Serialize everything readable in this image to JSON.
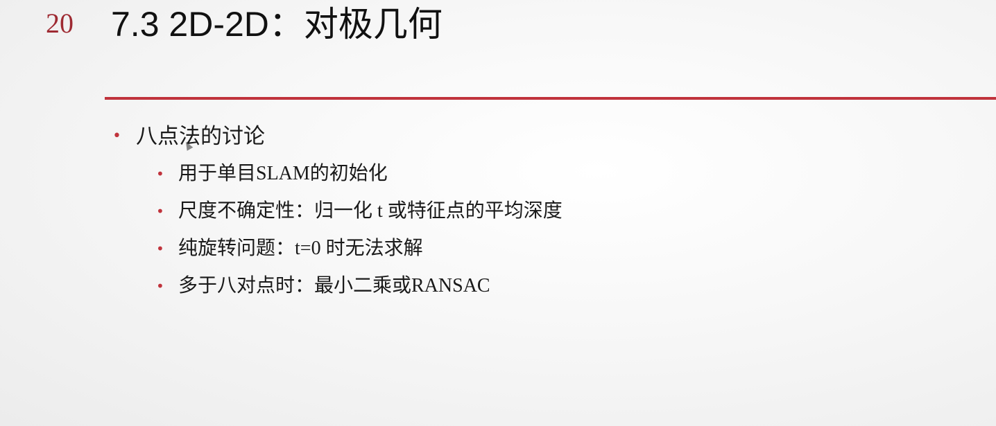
{
  "slide": {
    "number": "20",
    "title": "7.3 2D-2D：对极几何",
    "accent_color": "#c0333c",
    "bullets": [
      {
        "level": 1,
        "text": "八点法的讨论",
        "children": [
          {
            "level": 2,
            "text": "用于单目SLAM的初始化"
          },
          {
            "level": 2,
            "text": "尺度不确定性：归一化 t 或特征点的平均深度"
          },
          {
            "level": 2,
            "text": "纯旋转问题：t=0 时无法求解"
          },
          {
            "level": 2,
            "text": "多于八对点时：最小二乘或RANSAC"
          }
        ]
      }
    ],
    "bullet_glyph": "•"
  }
}
